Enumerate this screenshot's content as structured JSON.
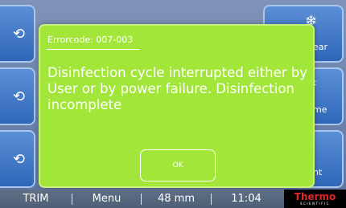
{
  "left_buttons": [
    {
      "icon": "arrow-icon",
      "glyph": "⟲"
    },
    {
      "icon": "arrow-icon",
      "glyph": "⟲"
    },
    {
      "icon": "arrow-icon",
      "glyph": "⟲"
    }
  ],
  "right_buttons": [
    {
      "icon": "snowflake-icon",
      "glyph": "❄",
      "label": "ear"
    },
    {
      "icon": "cut-icon",
      "glyph": "✂",
      "label": "me"
    },
    {
      "icon": "light-icon",
      "glyph": "⌂",
      "label": "ht"
    }
  ],
  "dialog": {
    "error_code": "Errorcode: 007-003",
    "message": "Disinfection cycle interrupted either by User or by power failure. Disinfection incomplete",
    "ok_label": "OK",
    "background_color": "#a3e63a"
  },
  "status_bar": {
    "mode": "TRIM",
    "menu": "Menu",
    "thickness": "48 mm",
    "time": "11:04",
    "logo_main": "Thermo",
    "logo_sub": "SCIENTIFIC"
  }
}
